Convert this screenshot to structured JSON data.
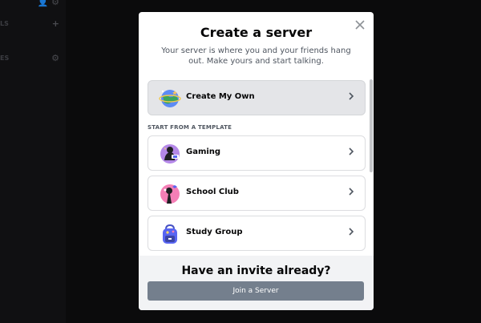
{
  "background": {
    "rows": [
      {
        "text": "",
        "glyph": "👤 ⚙"
      },
      {
        "text": "LS",
        "glyph": "+"
      },
      {
        "text": "ES",
        "glyph": "⚙"
      }
    ]
  },
  "modal": {
    "title": "Create a server",
    "subtitle": "Your server is where you and your friends hang out. Make yours and start talking.",
    "close_icon": "close-icon",
    "primary_option": {
      "label": "Create My Own",
      "icon": "globe-icon"
    },
    "section_label": "START FROM A TEMPLATE",
    "templates": [
      {
        "label": "Gaming",
        "icon": "gaming-icon"
      },
      {
        "label": "School Club",
        "icon": "school-club-icon"
      },
      {
        "label": "Study Group",
        "icon": "backpack-icon"
      }
    ],
    "footer": {
      "title": "Have an invite already?",
      "join_label": "Join a Server"
    }
  },
  "colors": {
    "brand": "#5865f2",
    "join_button": "#747f8d",
    "footer_bg": "#f2f3f5"
  }
}
